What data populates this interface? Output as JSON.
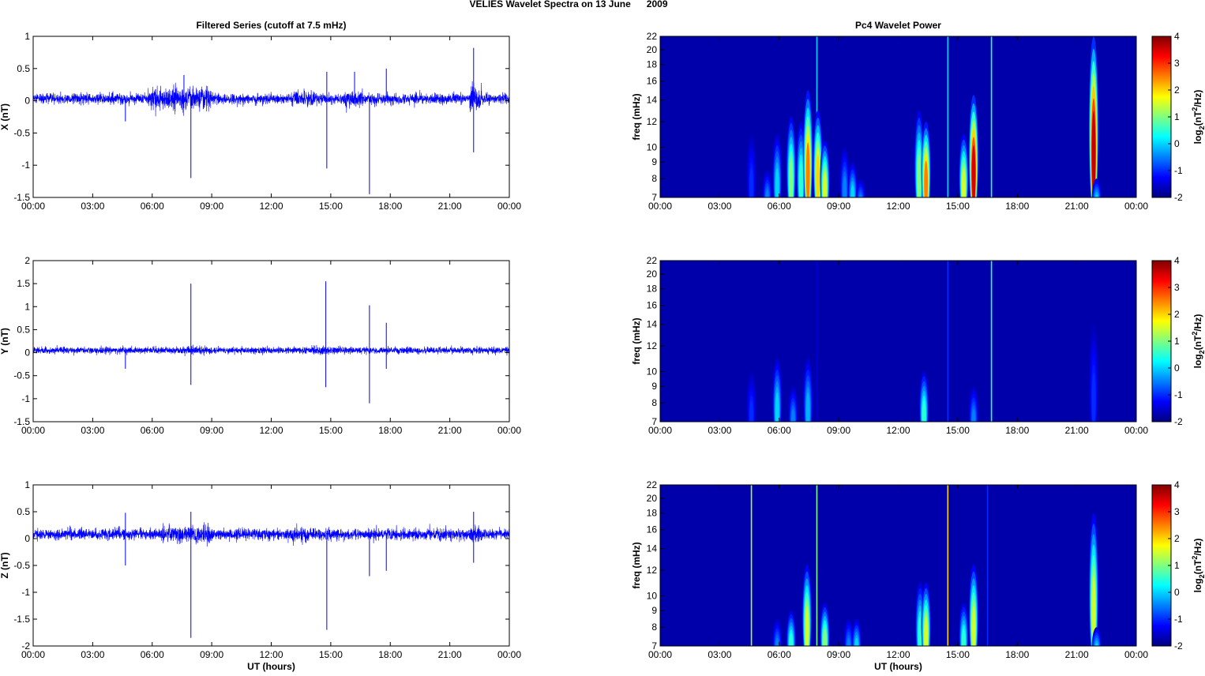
{
  "title": "VELIES Wavelet Spectra on 13 June      2009",
  "chart_data": [
    {
      "type": "line",
      "panel": "X",
      "title": "Filtered Series (cutoff at 7.5 mHz)",
      "ylabel": "X (nT)",
      "xlabel": "",
      "xlim": [
        0,
        24
      ],
      "ylim": [
        -1.5,
        1
      ],
      "yticks": [
        "1",
        "0.5",
        "0",
        "-0.5",
        "-1",
        "-1.5"
      ],
      "ytick_values": [
        1,
        0.5,
        0,
        -0.5,
        -1,
        -1.5
      ],
      "xticks": [
        "00:00",
        "03:00",
        "06:00",
        "09:00",
        "12:00",
        "15:00",
        "18:00",
        "21:00",
        "00:00"
      ],
      "baseline": 0.03,
      "noise_sd": 0.04,
      "active_intervals": [
        [
          5.8,
          9.0,
          2.2
        ],
        [
          13.0,
          14.2,
          1.6
        ],
        [
          15.7,
          16.6,
          1.8
        ],
        [
          22.0,
          22.6,
          2.5
        ]
      ],
      "spikes": [
        [
          4.65,
          -0.32
        ],
        [
          7.95,
          -1.2
        ],
        [
          7.6,
          0.4
        ],
        [
          14.8,
          -1.05
        ],
        [
          14.8,
          0.45
        ],
        [
          16.95,
          -1.45
        ],
        [
          17.8,
          0.5
        ],
        [
          22.2,
          0.82
        ],
        [
          22.2,
          -0.8
        ],
        [
          16.2,
          0.45
        ]
      ]
    },
    {
      "type": "line",
      "panel": "Y",
      "title": "",
      "ylabel": "Y (nT)",
      "xlabel": "",
      "xlim": [
        0,
        24
      ],
      "ylim": [
        -1.5,
        2
      ],
      "yticks": [
        "2",
        "1.5",
        "1",
        "0.5",
        "0",
        "-0.5",
        "-1",
        "-1.5"
      ],
      "ytick_values": [
        2,
        1.5,
        1,
        0.5,
        0,
        -0.5,
        -1,
        -1.5
      ],
      "xticks": [
        "00:00",
        "03:00",
        "06:00",
        "09:00",
        "12:00",
        "15:00",
        "18:00",
        "21:00",
        "00:00"
      ],
      "baseline": 0.05,
      "noise_sd": 0.035,
      "active_intervals": [
        [
          7.5,
          8.5,
          1.3
        ],
        [
          14.0,
          15.5,
          1.3
        ]
      ],
      "spikes": [
        [
          4.65,
          -0.35
        ],
        [
          7.95,
          1.5
        ],
        [
          7.95,
          -0.7
        ],
        [
          14.75,
          1.55
        ],
        [
          14.75,
          -0.75
        ],
        [
          16.95,
          1.03
        ],
        [
          16.95,
          -1.1
        ],
        [
          17.8,
          0.65
        ],
        [
          17.8,
          -0.35
        ]
      ]
    },
    {
      "type": "line",
      "panel": "Z",
      "title": "",
      "ylabel": "Z (nT)",
      "xlabel": "UT (hours)",
      "xlim": [
        0,
        24
      ],
      "ylim": [
        -2,
        1
      ],
      "yticks": [
        "1",
        "0.5",
        "0",
        "-0.5",
        "-1",
        "-1.5",
        "-2"
      ],
      "ytick_values": [
        1,
        0.5,
        0,
        -0.5,
        -1,
        -1.5,
        -2
      ],
      "xticks": [
        "00:00",
        "03:00",
        "06:00",
        "09:00",
        "12:00",
        "15:00",
        "18:00",
        "21:00",
        "00:00"
      ],
      "baseline": 0.08,
      "noise_sd": 0.05,
      "active_intervals": [
        [
          6.5,
          9.0,
          1.6
        ],
        [
          13.0,
          14.0,
          1.5
        ],
        [
          22.0,
          22.6,
          1.8
        ]
      ],
      "spikes": [
        [
          4.65,
          0.48
        ],
        [
          4.65,
          -0.5
        ],
        [
          7.95,
          0.5
        ],
        [
          7.95,
          -1.85
        ],
        [
          14.8,
          -1.7
        ],
        [
          16.95,
          -0.7
        ],
        [
          17.8,
          -0.6
        ],
        [
          22.2,
          0.5
        ],
        [
          22.2,
          -0.45
        ]
      ]
    },
    {
      "type": "heatmap",
      "panel": "X",
      "title": "Pc4 Wavelet Power",
      "ylabel": "freq (mHz)",
      "xlabel": "",
      "xlim": [
        0,
        24
      ],
      "ylim": [
        7,
        22
      ],
      "yscale": "log",
      "yticks": [
        "7",
        "8",
        "9",
        "10",
        "12",
        "14",
        "16",
        "18",
        "20",
        "22"
      ],
      "ytick_values": [
        7,
        8,
        9,
        10,
        12,
        14,
        16,
        18,
        20,
        22
      ],
      "xticks": [
        "00:00",
        "03:00",
        "06:00",
        "09:00",
        "12:00",
        "15:00",
        "18:00",
        "21:00",
        "00:00"
      ],
      "clim": [
        -2,
        4
      ],
      "colorbar_ticks": [
        "4",
        "3",
        "2",
        "1",
        "0",
        "-1",
        "-2"
      ],
      "colorbar_label": {
        "base": "log",
        "sub": "2",
        "mid": "(nT",
        "sup": "2",
        "end": "/Hz)"
      },
      "events": [
        {
          "t": 4.6,
          "fmax": 11,
          "peak": -1
        },
        {
          "t": 5.4,
          "fmax": 8.5,
          "peak": -0.5
        },
        {
          "t": 5.9,
          "fmax": 11,
          "peak": 0
        },
        {
          "t": 6.6,
          "fmax": 12.5,
          "peak": 1
        },
        {
          "t": 7.1,
          "fmax": 12,
          "peak": 0.5
        },
        {
          "t": 7.45,
          "fmax": 15,
          "peak": 2.5
        },
        {
          "t": 7.9,
          "fmax": 22,
          "peak": 0,
          "line": true
        },
        {
          "t": 7.95,
          "fmax": 13,
          "peak": 2
        },
        {
          "t": 8.3,
          "fmax": 10.5,
          "peak": 1.5
        },
        {
          "t": 9.3,
          "fmax": 10,
          "peak": -0.5
        },
        {
          "t": 9.7,
          "fmax": 9,
          "peak": 0
        },
        {
          "t": 10.1,
          "fmax": 8,
          "peak": -0.5
        },
        {
          "t": 13.05,
          "fmax": 13,
          "peak": 1
        },
        {
          "t": 13.4,
          "fmax": 12,
          "peak": 2.5
        },
        {
          "t": 14.5,
          "fmax": 22,
          "peak": 0,
          "line": true
        },
        {
          "t": 15.3,
          "fmax": 11,
          "peak": 1.5
        },
        {
          "t": 15.8,
          "fmax": 14.5,
          "peak": 3.5
        },
        {
          "t": 16.7,
          "fmax": 22,
          "peak": 0.5,
          "line": true
        },
        {
          "t": 21.85,
          "fmax": 22,
          "peak": 3.6
        },
        {
          "t": 22.0,
          "fmax": 8,
          "peak": 0
        }
      ]
    },
    {
      "type": "heatmap",
      "panel": "Y",
      "title": "",
      "ylabel": "freq (mHz)",
      "xlabel": "",
      "xlim": [
        0,
        24
      ],
      "ylim": [
        7,
        22
      ],
      "yscale": "log",
      "yticks": [
        "7",
        "8",
        "9",
        "10",
        "12",
        "14",
        "16",
        "18",
        "20",
        "22"
      ],
      "ytick_values": [
        7,
        8,
        9,
        10,
        12,
        14,
        16,
        18,
        20,
        22
      ],
      "xticks": [
        "00:00",
        "03:00",
        "06:00",
        "09:00",
        "12:00",
        "15:00",
        "18:00",
        "21:00",
        "00:00"
      ],
      "clim": [
        -2,
        4
      ],
      "colorbar_ticks": [
        "4",
        "3",
        "2",
        "1",
        "0",
        "-1",
        "-2"
      ],
      "colorbar_label": {
        "base": "log",
        "sub": "2",
        "mid": "(nT",
        "sup": "2",
        "end": "/Hz)"
      },
      "events": [
        {
          "t": 4.6,
          "fmax": 10,
          "peak": -1
        },
        {
          "t": 5.9,
          "fmax": 11,
          "peak": 0
        },
        {
          "t": 6.7,
          "fmax": 9,
          "peak": -0.5
        },
        {
          "t": 7.45,
          "fmax": 11,
          "peak": -0.2
        },
        {
          "t": 7.9,
          "fmax": 22,
          "peak": -1.5,
          "line": true
        },
        {
          "t": 13.3,
          "fmax": 10,
          "peak": 0.5
        },
        {
          "t": 14.5,
          "fmax": 22,
          "peak": -1,
          "line": true
        },
        {
          "t": 15.8,
          "fmax": 9,
          "peak": -0.5
        },
        {
          "t": 16.7,
          "fmax": 22,
          "peak": 0.5,
          "line": true
        },
        {
          "t": 21.85,
          "fmax": 14,
          "peak": -1
        }
      ]
    },
    {
      "type": "heatmap",
      "panel": "Z",
      "title": "",
      "ylabel": "freq (mHz)",
      "xlabel": "UT (hours)",
      "xlim": [
        0,
        24
      ],
      "ylim": [
        7,
        22
      ],
      "yscale": "log",
      "yticks": [
        "7",
        "8",
        "9",
        "10",
        "12",
        "14",
        "16",
        "18",
        "20",
        "22"
      ],
      "ytick_values": [
        7,
        8,
        9,
        10,
        12,
        14,
        16,
        18,
        20,
        22
      ],
      "xticks": [
        "00:00",
        "03:00",
        "06:00",
        "09:00",
        "12:00",
        "15:00",
        "18:00",
        "21:00",
        "00:00"
      ],
      "clim": [
        -2,
        4
      ],
      "colorbar_ticks": [
        "4",
        "3",
        "2",
        "1",
        "0",
        "-1",
        "-2"
      ],
      "colorbar_label": {
        "base": "log",
        "sub": "2",
        "mid": "(nT",
        "sup": "2",
        "end": "/Hz)"
      },
      "events": [
        {
          "t": 4.6,
          "fmax": 22,
          "peak": 1.2,
          "line": true
        },
        {
          "t": 5.9,
          "fmax": 8.5,
          "peak": -0.5
        },
        {
          "t": 6.6,
          "fmax": 9,
          "peak": 0.5
        },
        {
          "t": 7.4,
          "fmax": 12.5,
          "peak": 1.5
        },
        {
          "t": 7.9,
          "fmax": 22,
          "peak": 1,
          "line": true
        },
        {
          "t": 8.3,
          "fmax": 9.5,
          "peak": 1
        },
        {
          "t": 9.5,
          "fmax": 8.5,
          "peak": -0.5
        },
        {
          "t": 9.9,
          "fmax": 8.5,
          "peak": 0
        },
        {
          "t": 13.1,
          "fmax": 11,
          "peak": 0.5
        },
        {
          "t": 13.4,
          "fmax": 11,
          "peak": 1.5
        },
        {
          "t": 14.5,
          "fmax": 22,
          "peak": 2,
          "line": true
        },
        {
          "t": 15.3,
          "fmax": 9.5,
          "peak": 0.5
        },
        {
          "t": 15.8,
          "fmax": 12.5,
          "peak": 1.5
        },
        {
          "t": 16.5,
          "fmax": 22,
          "peak": -1,
          "line": true
        },
        {
          "t": 21.85,
          "fmax": 18,
          "peak": 1.5
        },
        {
          "t": 22.0,
          "fmax": 8,
          "peak": 0
        }
      ]
    }
  ]
}
